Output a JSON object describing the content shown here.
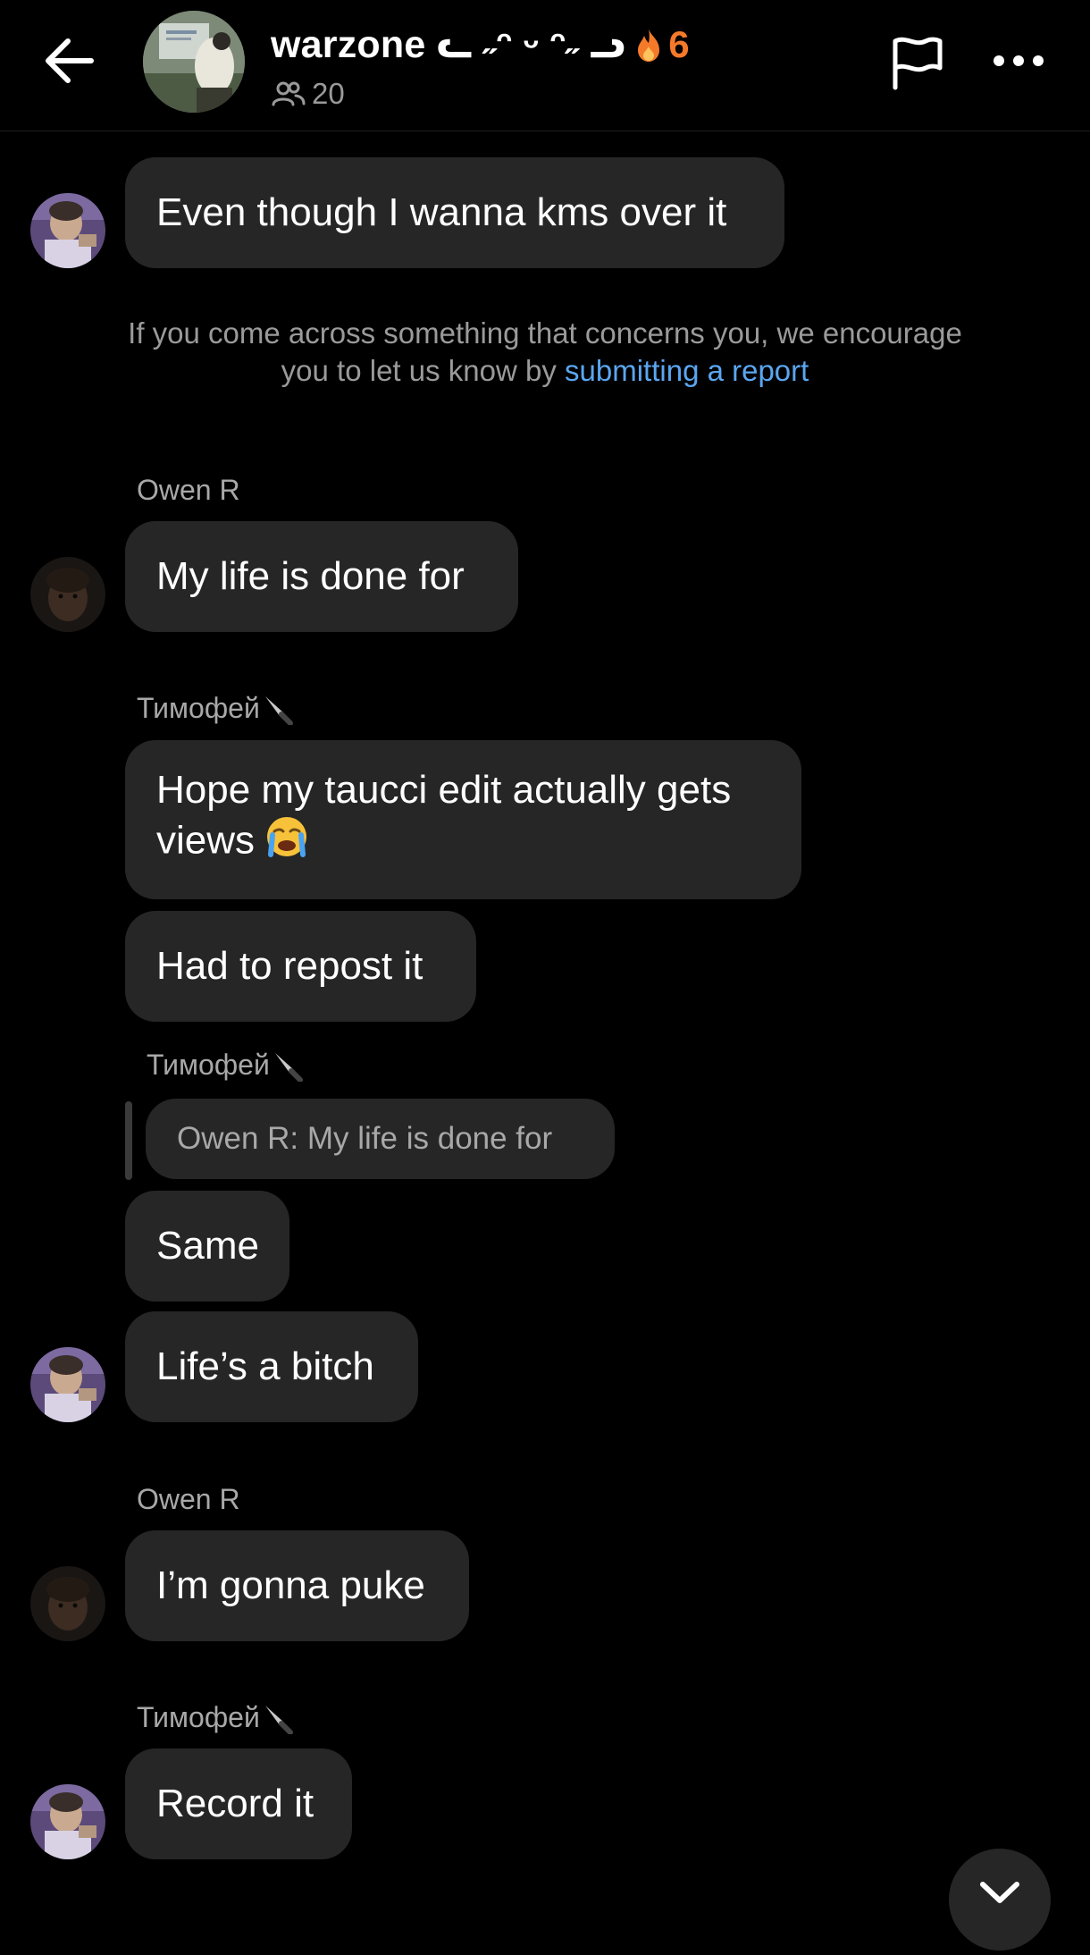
{
  "header": {
    "group_name": "warzone ᓚ ˶ᵔ ᵕ ᵔ˶ ᓗ",
    "streak_count": "6",
    "member_count": "20",
    "icons": {
      "back": "arrow-left-icon",
      "flag": "flag-icon",
      "more": "more-horizontal-icon",
      "members": "people-icon",
      "streak": "fire-icon"
    },
    "streak_color": "#f47a2a"
  },
  "notice": {
    "text": "If you come across something that concerns you, we encourage you to let us know by ",
    "link": "submitting a report",
    "link_color": "#5ba6f0"
  },
  "messages": [
    {
      "sender": "",
      "text": "Even though I wanna kms over it"
    },
    {
      "sender": "Owen R",
      "text": "My life is done for"
    },
    {
      "sender": "Тимофей",
      "text": "Hope my taucci edit actually gets views"
    },
    {
      "sender": "",
      "text": "Had to repost it"
    },
    {
      "sender": "Тимофей",
      "reply_to": "Owen R: My life is done for",
      "text": "Same"
    },
    {
      "sender": "",
      "text": "Life’s a bitch"
    },
    {
      "sender": "Owen R",
      "text": "I’m gonna puke"
    },
    {
      "sender": "Тимофей",
      "text": "Record it"
    }
  ],
  "colors": {
    "background": "#000000",
    "bubble": "#262626",
    "secondary_text": "#a8a8a8"
  }
}
